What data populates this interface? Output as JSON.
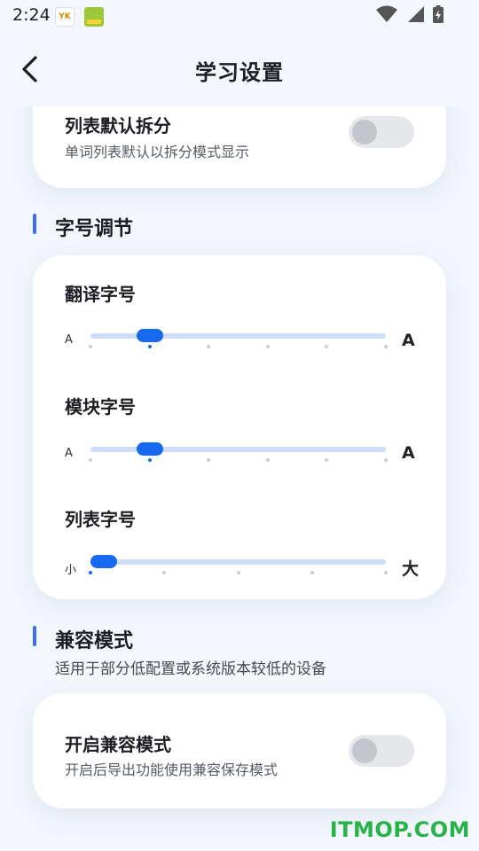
{
  "status_bar": {
    "time": "2:24",
    "app_icon_1_text": "YK",
    "wifi_icon": "wifi-icon",
    "signal_icon": "signal-icon",
    "battery_icon": "battery-charging-icon"
  },
  "header": {
    "title": "学习设置",
    "back_icon": "back-arrow-icon"
  },
  "split_card": {
    "title": "列表默认拆分",
    "subtitle": "单词列表默认以拆分模式显示",
    "toggle_on": false
  },
  "font_section": {
    "title": "字号调节",
    "sliders": [
      {
        "label": "翻译字号",
        "min_label": "A",
        "max_label": "A",
        "steps": 6,
        "value_index": 1
      },
      {
        "label": "模块字号",
        "min_label": "A",
        "max_label": "A",
        "steps": 6,
        "value_index": 1
      },
      {
        "label": "列表字号",
        "min_label": "小",
        "max_label": "大",
        "steps": 5,
        "value_index": 0
      }
    ]
  },
  "compat_section": {
    "title": "兼容模式",
    "description": "适用于部分低配置或系统版本较低的设备",
    "card": {
      "title": "开启兼容模式",
      "subtitle": "开启后导出功能使用兼容保存模式",
      "toggle_on": false
    }
  },
  "watermark": "ITMOP.COM",
  "colors": {
    "accent": "#1769f0",
    "section_bar": "#3d6df2",
    "track": "#cfdef8",
    "background": "#f3f6fc",
    "watermark": "#27b34a"
  }
}
